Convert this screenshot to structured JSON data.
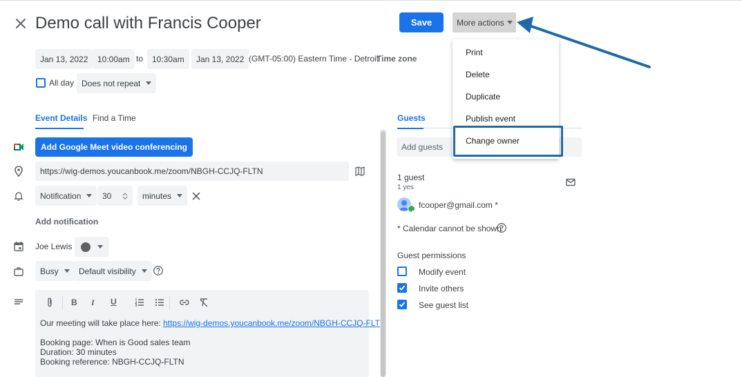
{
  "event": {
    "title": "Demo call with Francis Cooper"
  },
  "header": {
    "save_label": "Save",
    "more_actions_label": "More actions"
  },
  "datetime": {
    "start_date": "Jan 13, 2022",
    "start_time": "10:00am",
    "to_label": "to",
    "end_time": "10:30am",
    "end_date": "Jan 13, 2022",
    "timezone": "(GMT-05:00) Eastern Time - Detroit",
    "timezone_link": "Time zone",
    "all_day_label": "All day",
    "repeat_value": "Does not repeat"
  },
  "tabs": {
    "event_details": "Event Details",
    "find_a_time": "Find a Time",
    "guests": "Guests"
  },
  "details": {
    "meet_button": "Add Google Meet video conferencing",
    "location": "https://wig-demos.youcanbook.me/zoom/NBGH-CCJQ-FLTN",
    "notification_type": "Notification",
    "notification_amount": "30",
    "notification_unit": "minutes",
    "add_notification": "Add notification",
    "calendar_owner": "Joe Lewis",
    "availability": "Busy",
    "visibility": "Default visibility"
  },
  "description": {
    "line1_prefix": "Our meeting will take place here: ",
    "line1_link": "https://wig-demos.youcanbook.me/zoom/NBGH-CCJQ-FLTN",
    "line2": "Booking page: When is Good sales team",
    "line3": "Duration: 30 minutes",
    "line4": "Booking reference: NBGH-CCJQ-FLTN"
  },
  "menu": {
    "items": [
      "Print",
      "Delete",
      "Duplicate",
      "Publish event",
      "Change owner"
    ]
  },
  "guests": {
    "add_placeholder": "Add guests",
    "count_label": "1 guest",
    "yes_label": "1 yes",
    "guest_email": "fcooper@gmail.com *",
    "calendar_note": "* Calendar cannot be shown",
    "permissions_title": "Guest permissions",
    "permissions": [
      {
        "label": "Modify event",
        "checked": false
      },
      {
        "label": "Invite others",
        "checked": true
      },
      {
        "label": "See guest list",
        "checked": true
      }
    ]
  },
  "colors": {
    "primary": "#1a73e8",
    "annotation": "#1f6aa5",
    "calendar_color": "#616161"
  }
}
